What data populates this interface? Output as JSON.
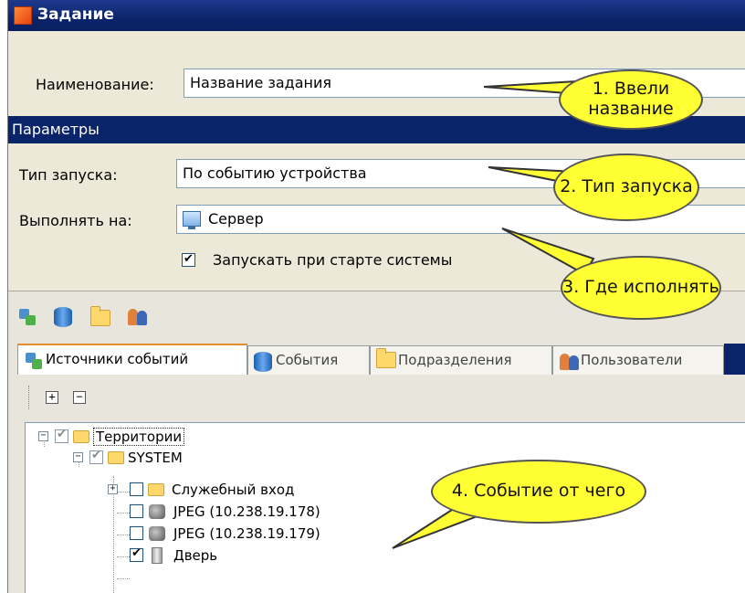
{
  "window": {
    "title": "Задание"
  },
  "form": {
    "name_label": "Наименование:",
    "name_value": "Название задания",
    "section_title": "Параметры",
    "launch_label": "Тип запуска:",
    "launch_value": "По событию устройства",
    "run_on_label": "Выполнять на:",
    "run_on_value": "Сервер",
    "autostart_label": "Запускать при старте системы",
    "autostart_checked": true
  },
  "toolbar": {
    "icons": [
      "event-sources-icon",
      "events-icon",
      "departments-icon",
      "users-icon"
    ]
  },
  "tabs": [
    {
      "label": "Источники событий",
      "icon": "event-sources-icon",
      "active": true
    },
    {
      "label": "События",
      "icon": "events-icon",
      "active": false
    },
    {
      "label": "Подразделения",
      "icon": "folder-icon",
      "active": false
    },
    {
      "label": "Пользователи",
      "icon": "users-icon",
      "active": false
    }
  ],
  "tree": {
    "items": [
      {
        "label": "Территории",
        "checked": true
      },
      {
        "label": "SYSTEM",
        "checked": true
      },
      {
        "label": "Служебный вход",
        "checked": false
      },
      {
        "label": "JPEG (10.238.19.178)",
        "checked": false
      },
      {
        "label": "JPEG (10.238.19.179)",
        "checked": false
      },
      {
        "label": "Дверь",
        "checked": true
      }
    ]
  },
  "callouts": [
    {
      "text": "1. Ввели название"
    },
    {
      "text": "2. Тип запуска"
    },
    {
      "text": "3. Где исполнять"
    },
    {
      "text": "4. Событие от чего"
    }
  ],
  "colors": {
    "titlebar": "#0a246a",
    "callout": "#ffff33",
    "tab_accent": "#e68b2c"
  }
}
